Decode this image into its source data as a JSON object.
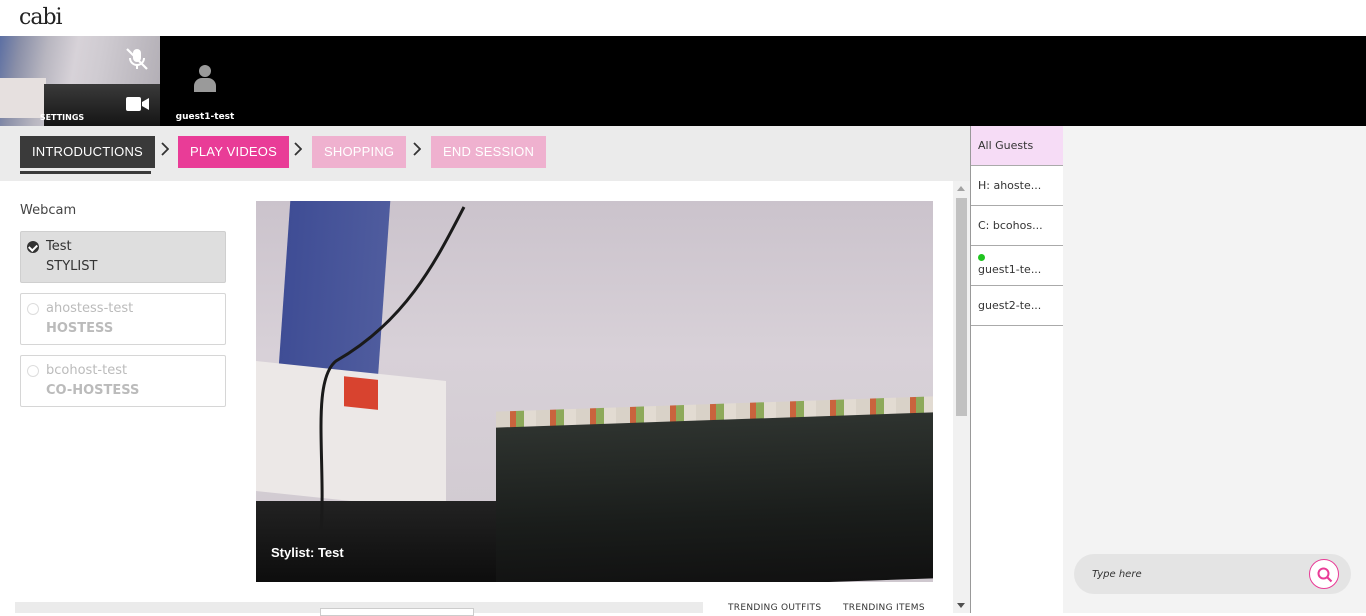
{
  "app": {
    "logo": "cabi"
  },
  "video_strip": {
    "self_label": "SETTINGS",
    "guest_name": "guest1-test"
  },
  "steps": [
    {
      "label": "INTRODUCTIONS",
      "state": "active"
    },
    {
      "label": "PLAY VIDEOS",
      "state": "next"
    },
    {
      "label": "SHOPPING",
      "state": "disabled"
    },
    {
      "label": "END SESSION",
      "state": "disabled"
    }
  ],
  "webcam": {
    "label": "Webcam",
    "options": [
      {
        "name": "Test",
        "role": "STYLIST",
        "selected": true
      },
      {
        "name": "ahostess-test",
        "role": "HOSTESS",
        "selected": false
      },
      {
        "name": "bcohost-test",
        "role": "CO-HOSTESS",
        "selected": false
      }
    ]
  },
  "main_video": {
    "caption": "Stylist: Test"
  },
  "bottom": {
    "trending_outfits": "TRENDING OUTFITS",
    "trending_items": "TRENDING ITEMS"
  },
  "guests": [
    {
      "label": "All Guests",
      "selected": true,
      "online": false
    },
    {
      "label": "H: ahoste...",
      "selected": false,
      "online": false
    },
    {
      "label": "C: bcohos...",
      "selected": false,
      "online": false
    },
    {
      "label": "guest1-te...",
      "selected": false,
      "online": true
    },
    {
      "label": "guest2-te...",
      "selected": false,
      "online": false
    }
  ],
  "chat": {
    "placeholder": "Type here"
  },
  "colors": {
    "accent": "#e93c97",
    "accent_light": "#efb1cf",
    "dark": "#3a3a3a",
    "online": "#1fc41f"
  }
}
